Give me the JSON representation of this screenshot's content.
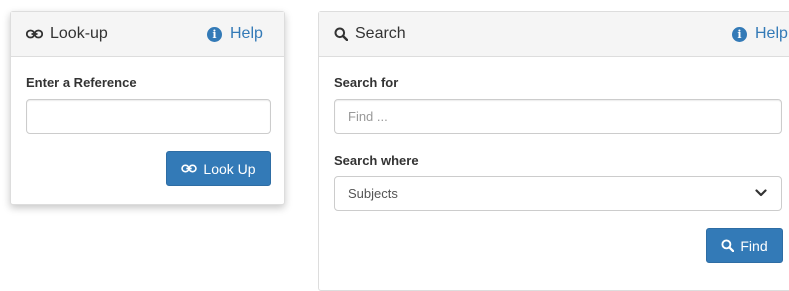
{
  "lookup": {
    "title": "Look-up",
    "title_icon": "chain-link-icon",
    "help_label": "Help",
    "help_icon": "info-circle-icon",
    "reference_label": "Enter a Reference",
    "reference_value": "",
    "button_label": "Look Up",
    "button_icon": "chain-link-icon"
  },
  "search": {
    "title": "Search",
    "title_icon": "magnifier-icon",
    "help_label": "Help",
    "help_icon": "info-circle-icon",
    "search_for_label": "Search for",
    "search_for_placeholder": "Find ...",
    "search_for_value": "",
    "search_where_label": "Search where",
    "search_where_selected": "Subjects",
    "button_label": "Find",
    "button_icon": "magnifier-icon"
  },
  "colors": {
    "accent": "#337ab7",
    "heading_bg": "#f5f5f5",
    "border": "#dddddd"
  }
}
